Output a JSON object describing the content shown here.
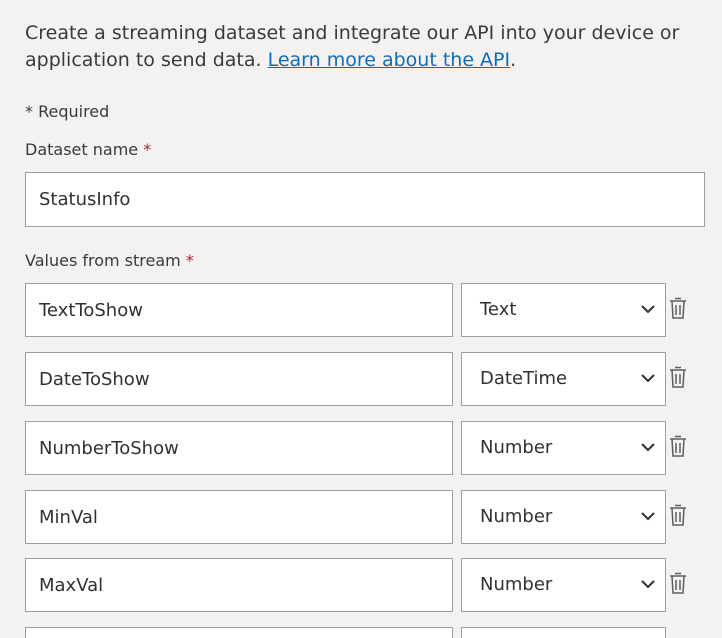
{
  "intro": {
    "text": "Create a streaming dataset and integrate our API into your device or application to send data. ",
    "link": "Learn more about the API",
    "tail": "."
  },
  "required_note": "* Required",
  "dataset": {
    "label": "Dataset name",
    "asterisk": "*",
    "value": "StatusInfo"
  },
  "values_label": {
    "label": "Values from stream",
    "asterisk": "*"
  },
  "rows": [
    {
      "name": "TextToShow",
      "type": "Text"
    },
    {
      "name": "DateToShow",
      "type": "DateTime"
    },
    {
      "name": "NumberToShow",
      "type": "Number"
    },
    {
      "name": "MinVal",
      "type": "Number"
    },
    {
      "name": "MaxVal",
      "type": "Number"
    }
  ],
  "icons": {
    "delete": "trash-icon",
    "dropdown": "chevron-down-icon"
  },
  "colors": {
    "link": "#0f6cbd",
    "required": "#a4262c",
    "background": "#f3f2f1",
    "border": "#a19f9d"
  }
}
